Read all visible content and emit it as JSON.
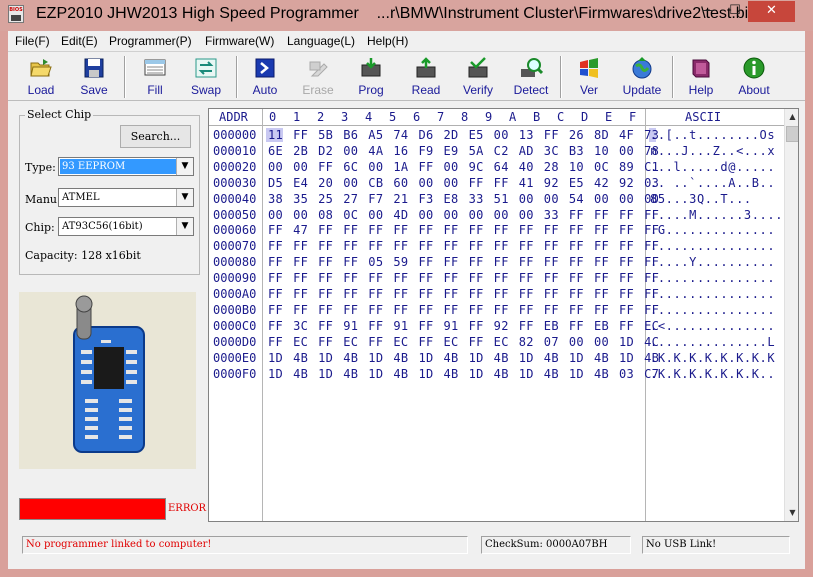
{
  "window": {
    "title": "EZP2010 JHW2013 High Speed Programmer    ...r\\BMW\\Instrument Cluster\\Firmwares\\drive2\\test.bin",
    "icon_label": "BIOS",
    "controls": {
      "minimize": "—",
      "maximize": "☐",
      "close": "✕"
    }
  },
  "menu": [
    {
      "label": "File(F)",
      "accel": "F"
    },
    {
      "label": "Edit(E)",
      "accel": "E"
    },
    {
      "label": "Programmer(P)",
      "accel": "P"
    },
    {
      "label": "Firmware(W)",
      "accel": "W"
    },
    {
      "label": "Language(L)",
      "accel": "L"
    },
    {
      "label": "Help(H)",
      "accel": "H"
    }
  ],
  "toolbar": [
    {
      "label": "Load",
      "icon": "folder-open-icon",
      "enabled": true
    },
    {
      "label": "Save",
      "icon": "floppy-disk-icon",
      "enabled": true
    },
    {
      "label": "Fill",
      "icon": "fill-icon",
      "enabled": true
    },
    {
      "label": "Swap",
      "icon": "swap-icon",
      "enabled": true
    },
    {
      "label": "Auto",
      "icon": "auto-icon",
      "enabled": true
    },
    {
      "label": "Erase",
      "icon": "eraser-icon",
      "enabled": false
    },
    {
      "label": "Prog",
      "icon": "chip-write-icon",
      "enabled": true
    },
    {
      "label": "Read",
      "icon": "chip-read-icon",
      "enabled": true
    },
    {
      "label": "Verify",
      "icon": "verify-icon",
      "enabled": true
    },
    {
      "label": "Detect",
      "icon": "magnifier-icon",
      "enabled": true
    },
    {
      "label": "Ver",
      "icon": "windows-flag-icon",
      "enabled": true
    },
    {
      "label": "Update",
      "icon": "globe-update-icon",
      "enabled": true
    },
    {
      "label": "Help",
      "icon": "help-book-icon",
      "enabled": true
    },
    {
      "label": "About",
      "icon": "info-icon",
      "enabled": true
    }
  ],
  "select_chip": {
    "title": "Select Chip",
    "search_label": "Search...",
    "type_label": "Type:",
    "type_value": "93 EEPROM",
    "manu_label": "Manu:",
    "manu_value": "ATMEL",
    "chip_label": "Chip:",
    "chip_value": "AT93C56(16bit)",
    "capacity": "Capacity: 128 x16bit"
  },
  "status_indicator": {
    "label": "ERROR",
    "color": "#ff0000"
  },
  "hex": {
    "addr_header": "ADDR",
    "col_headers": [
      "0",
      "1",
      "2",
      "3",
      "4",
      "5",
      "6",
      "7",
      "8",
      "9",
      "A",
      "B",
      "C",
      "D",
      "E",
      "F"
    ],
    "ascii_header": "ASCII",
    "rows": [
      {
        "addr": "000000",
        "bytes": "11 FF 5B B6 A5 74 D6 2D E5 00 13 FF 26 8D 4F 73",
        "ascii": "..[..t........Os"
      },
      {
        "addr": "000010",
        "bytes": "6E 2B D2 00 4A 16 F9 E9 5A C2 AD 3C B3 10 00 78",
        "ascii": "n...J...Z..<...x"
      },
      {
        "addr": "000020",
        "bytes": "00 00 FF 6C 00 1A FF 00 9C 64 40 28 10 0C 89 C1",
        "ascii": "...l.....d@....."
      },
      {
        "addr": "000030",
        "bytes": "D5 E4 20 00 CB 60 00 00 FF FF 41 92 E5 42 92 03",
        "ascii": ".. ..`....A..B.."
      },
      {
        "addr": "000040",
        "bytes": "38 35 25 27 F7 21 F3 E8 33 51 00 00 54 00 00 00",
        "ascii": "85...3Q..T..."
      },
      {
        "addr": "000050",
        "bytes": "00 00 08 0C 00 4D 00 00 00 00 00 33 FF FF FF FF",
        "ascii": ".....M......3...."
      },
      {
        "addr": "000060",
        "bytes": "FF 47 FF FF FF FF FF FF FF FF FF FF FF FF FF FF",
        "ascii": ".G.............."
      },
      {
        "addr": "000070",
        "bytes": "FF FF FF FF FF FF FF FF FF FF FF FF FF FF FF FF",
        "ascii": "................"
      },
      {
        "addr": "000080",
        "bytes": "FF FF FF FF 05 59 FF FF FF FF FF FF FF FF FF FF",
        "ascii": ".....Y.........."
      },
      {
        "addr": "000090",
        "bytes": "FF FF FF FF FF FF FF FF FF FF FF FF FF FF FF FF",
        "ascii": "................"
      },
      {
        "addr": "0000A0",
        "bytes": "FF FF FF FF FF FF FF FF FF FF FF FF FF FF FF FF",
        "ascii": "................"
      },
      {
        "addr": "0000B0",
        "bytes": "FF FF FF FF FF FF FF FF FF FF FF FF FF FF FF FF",
        "ascii": "................"
      },
      {
        "addr": "0000C0",
        "bytes": "FF 3C FF 91 FF 91 FF 91 FF 92 FF EB FF EB FF EC",
        "ascii": ".<.............."
      },
      {
        "addr": "0000D0",
        "bytes": "FF EC FF EC FF EC FF EC FF EC 82 07 00 00 1D 4C",
        "ascii": "...............L"
      },
      {
        "addr": "0000E0",
        "bytes": "1D 4B 1D 4B 1D 4B 1D 4B 1D 4B 1D 4B 1D 4B 1D 4B",
        "ascii": ".K.K.K.K.K.K.K.K"
      },
      {
        "addr": "0000F0",
        "bytes": "1D 4B 1D 4B 1D 4B 1D 4B 1D 4B 1D 4B 1D 4B 03 C7",
        "ascii": ".K.K.K.K.K.K.K.."
      }
    ]
  },
  "statusbar": {
    "message": "No programmer linked to computer!",
    "checksum": "CheckSum: 0000A07BH",
    "usb": "No USB Link!"
  },
  "colors": {
    "accent_text": "#1a1a8c",
    "error": "#ff0000",
    "error_text": "#e00000",
    "title_bg": "#d8a49e",
    "close_btn": "#c7463b",
    "selection": "#3399ff"
  }
}
